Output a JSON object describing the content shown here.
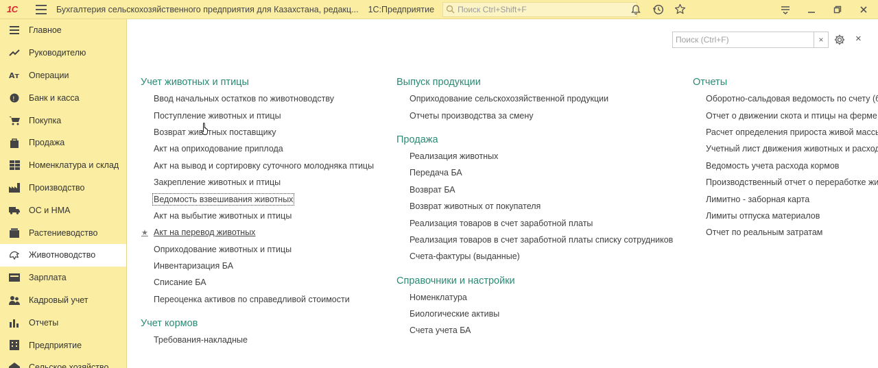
{
  "topbar": {
    "logo": "1С",
    "title": "Бухгалтерия сельскохозяйственного предприятия для Казахстана, редакц...",
    "subtitle": "1С:Предприятие",
    "search_placeholder": "Поиск Ctrl+Shift+F",
    "icons": [
      "bell-icon",
      "history-icon",
      "star-icon",
      "settings-lines-icon",
      "minimize-icon",
      "restore-icon",
      "close-icon"
    ]
  },
  "sidebar": {
    "items": [
      {
        "label": "Главное",
        "icon": "menu-lines-icon"
      },
      {
        "label": "Руководителю",
        "icon": "trend-icon"
      },
      {
        "label": "Операции",
        "icon": "operations-icon"
      },
      {
        "label": "Банк и касса",
        "icon": "coin-icon"
      },
      {
        "label": "Покупка",
        "icon": "cart-icon"
      },
      {
        "label": "Продажа",
        "icon": "bag-icon"
      },
      {
        "label": "Номенклатура и склад",
        "icon": "grid-icon"
      },
      {
        "label": "Производство",
        "icon": "factory-icon"
      },
      {
        "label": "ОС и НМА",
        "icon": "truck-icon"
      },
      {
        "label": "Растениеводство",
        "icon": "box-icon"
      },
      {
        "label": "Животноводство",
        "icon": "animal-icon",
        "active": true
      },
      {
        "label": "Зарплата",
        "icon": "salary-icon"
      },
      {
        "label": "Кадровый учет",
        "icon": "people-icon"
      },
      {
        "label": "Отчеты",
        "icon": "bars-icon"
      },
      {
        "label": "Предприятие",
        "icon": "building-icon"
      },
      {
        "label": "Сельское хозяйство",
        "icon": "farm-icon"
      }
    ]
  },
  "panel": {
    "search_placeholder": "Поиск (Ctrl+F)",
    "clear_label": "×",
    "close_label": "×"
  },
  "columns": [
    {
      "sections": [
        {
          "title": "Учет животных и птицы",
          "links": [
            "Ввод начальных остатков по животноводству",
            "Поступление животных и птицы",
            "Возврат животных поставщику",
            "Акт на оприходование приплода",
            "Акт на вывод и сортировку суточного молодняка птицы",
            "Закрепление животных и птицы",
            "Ведомость взвешивания животных",
            "Акт на выбытие животных и птицы",
            "Акт на перевод животных",
            "Оприходование животных и птицы",
            "Инвентаризация БА",
            "Списание БА",
            "Переоценка активов по справедливой стоимости"
          ]
        },
        {
          "title": "Учет кормов",
          "links": [
            "Требования-накладные"
          ]
        }
      ]
    },
    {
      "sections": [
        {
          "title": "Выпуск продукции",
          "links": [
            "Оприходование сельскохозяйственной продукции",
            "Отчеты производства за смену"
          ]
        },
        {
          "title": "Продажа",
          "links": [
            "Реализация животных",
            "Передача БА",
            "Возврат БА",
            "Возврат животных от покупателя",
            "Реализация товаров в счет заработной платы",
            "Реализация товаров в счет заработной платы списку сотрудников",
            "Счета-фактуры (выданные)"
          ]
        },
        {
          "title": "Справочники и настройки",
          "links": [
            "Номенклатура",
            "Биологические активы",
            "Счета учета БА"
          ]
        }
      ]
    },
    {
      "sections": [
        {
          "title": "Отчеты",
          "links": [
            "Оборотно-сальдовая ведомость по счету (б",
            "Отчет о движении скота и птицы на ферме",
            "Расчет определения прироста живой массы",
            "Учетный лист движения животных и расход",
            "Ведомость учета расхода кормов",
            "Производственный отчет о переработке жив",
            "Лимитно - заборная карта",
            "Лимиты отпуска материалов",
            "Отчет по реальным затратам"
          ]
        }
      ]
    }
  ]
}
